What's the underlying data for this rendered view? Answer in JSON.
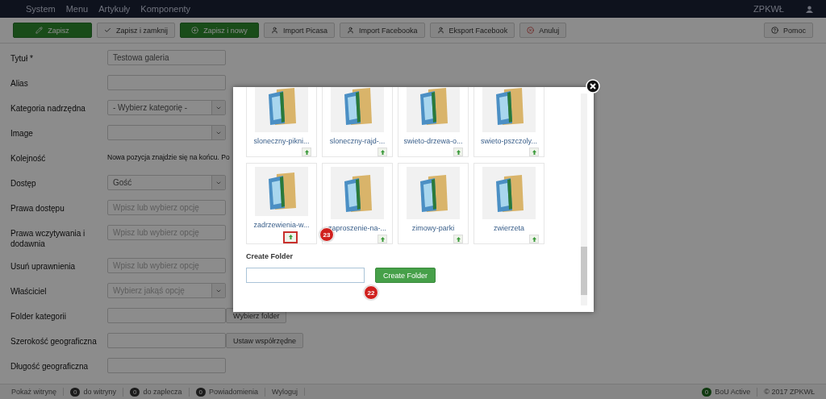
{
  "navbar": {
    "menu": [
      "System",
      "Menu",
      "Artykuły",
      "Komponenty"
    ],
    "site": "ZPKWŁ"
  },
  "toolbar": {
    "buttons": [
      {
        "label": "Zapisz",
        "kind": "success"
      },
      {
        "label": "Zapisz i zamknij",
        "kind": "default"
      },
      {
        "label": "Zapisz i nowy",
        "kind": "success"
      },
      {
        "label": "Import Picasa",
        "kind": "default"
      },
      {
        "label": "Import Facebooka",
        "kind": "default"
      },
      {
        "label": "Eksport Facebook",
        "kind": "default"
      },
      {
        "label": "Anuluj",
        "kind": "default"
      }
    ],
    "help": "Pomoc"
  },
  "form": {
    "rows": [
      {
        "label": "Tytuł *",
        "kind": "input",
        "value": "Testowa galeria"
      },
      {
        "label": "Alias",
        "kind": "input"
      },
      {
        "label": "Kategoria nadrzędna",
        "kind": "select",
        "value": "- Wybierz kategorię -"
      },
      {
        "label": "Image",
        "kind": "select"
      },
      {
        "label": "Kolejność",
        "kind": "text",
        "value": "Nowa pozycja znajdzie się na końcu. Po"
      },
      {
        "label": "Dostęp",
        "kind": "select",
        "value": "Gość"
      },
      {
        "label": "Prawa dostępu",
        "kind": "input",
        "placeholder": "Wpisz lub wybierz opcję"
      },
      {
        "label": "Prawa wczytywania i dodawnia",
        "kind": "input",
        "placeholder": "Wpisz lub wybierz opcję"
      },
      {
        "label": "Usuń uprawnienia",
        "kind": "input",
        "placeholder": "Wpisz lub wybierz opcję"
      },
      {
        "label": "Właściciel",
        "kind": "select",
        "placeholder": "Wybierz jakąś opcję"
      },
      {
        "label": "Folder kategorii",
        "kind": "input",
        "button": "Wybierz folder"
      },
      {
        "label": "Szerokość geograficzna",
        "kind": "input",
        "button": "Ustaw współrzędne"
      },
      {
        "label": "Długość geograficzna",
        "kind": "input"
      }
    ]
  },
  "modal": {
    "folders": [
      {
        "name": "sloneczny-pikni...",
        "highlighted": false
      },
      {
        "name": "sloneczny-rajd-...",
        "highlighted": false
      },
      {
        "name": "swieto-drzewa-o...",
        "highlighted": false
      },
      {
        "name": "swieto-pszczoly...",
        "highlighted": false
      },
      {
        "name": "zadrzewienia-w...",
        "highlighted": true,
        "badge": "23"
      },
      {
        "name": "zaproszenie-na-...",
        "highlighted": false
      },
      {
        "name": "zimowy-parki",
        "highlighted": false
      },
      {
        "name": "zwierzeta",
        "highlighted": false
      }
    ],
    "create_folder": {
      "title": "Create Folder",
      "button": "Create Folder",
      "badge": "22"
    }
  },
  "footer": {
    "items": [
      {
        "label": "Pokaż witrynę"
      },
      {
        "count": "0",
        "label": "do witryny"
      },
      {
        "count": "0",
        "label": "do zaplecza"
      },
      {
        "count": "0",
        "label": "Powiadomienia"
      },
      {
        "label": "Wyloguj"
      }
    ],
    "status": {
      "count": "0",
      "label": "BoU Active"
    },
    "copyright": "© 2017 ZPKWŁ"
  }
}
